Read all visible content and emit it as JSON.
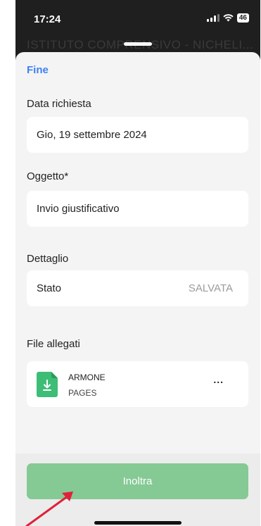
{
  "status_bar": {
    "time": "17:24",
    "battery": "46"
  },
  "background": {
    "title": "ISTITUTO COMPRENSIVO - NICHELI..."
  },
  "sheet": {
    "done_label": "Fine",
    "date_section": {
      "label": "Data richiesta",
      "value": "Gio, 19 settembre 2024"
    },
    "subject_section": {
      "label": "Oggetto*",
      "value": "Invio giustificativo"
    },
    "detail_section": {
      "label": "Dettaglio",
      "status_label": "Stato",
      "status_value": "SALVATA"
    },
    "attachments_section": {
      "label": "File allegati",
      "file": {
        "name": "ARMONE",
        "type": "PAGES",
        "icon": "download-file-icon",
        "more_label": "..."
      }
    },
    "submit_label": "Inoltra"
  },
  "colors": {
    "accent": "#3b82f6",
    "submit_button": "#85c995",
    "file_icon": "#3dbd76",
    "annotation_arrow": "#e0203a"
  }
}
